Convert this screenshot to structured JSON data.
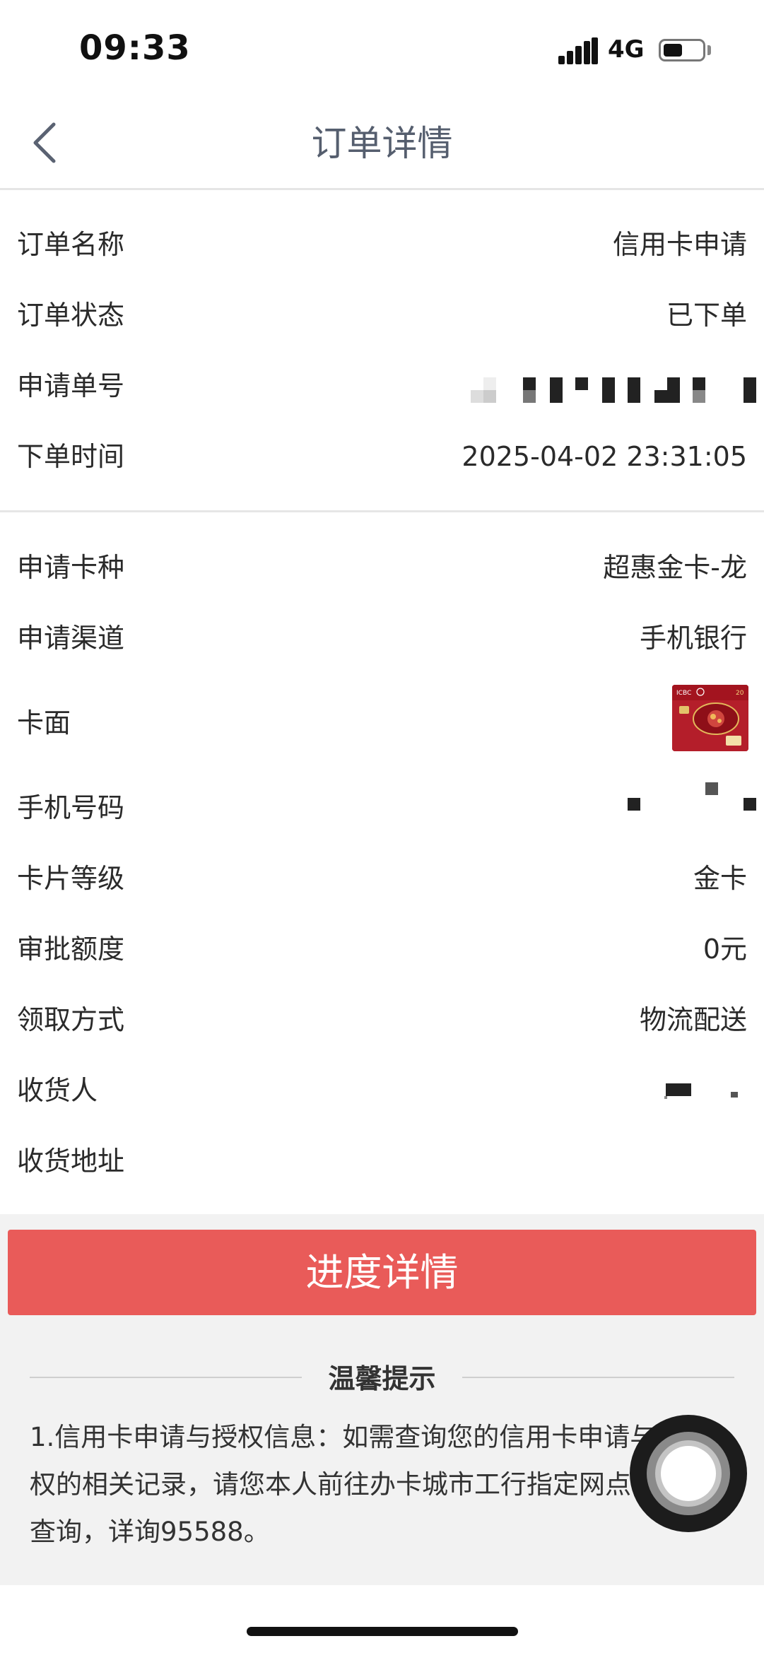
{
  "status_bar": {
    "time": "09:33",
    "network": "4G",
    "battery_level": 0.5
  },
  "nav": {
    "title": "订单详情",
    "back_icon": "chevron-left-icon"
  },
  "order_info": [
    {
      "label": "订单名称",
      "value": "信用卡申请"
    },
    {
      "label": "订单状态",
      "value": "已下单"
    },
    {
      "label": "申请单号",
      "value": ""
    },
    {
      "label": "下单时间",
      "value": "2025-04-02 23:31:05"
    }
  ],
  "card_info": [
    {
      "label": "申请卡种",
      "value": "超惠金卡-龙"
    },
    {
      "label": "申请渠道",
      "value": "手机银行"
    },
    {
      "label": "卡面",
      "value": ""
    },
    {
      "label": "手机号码",
      "value": ""
    },
    {
      "label": "卡片等级",
      "value": "金卡"
    },
    {
      "label": "审批额度",
      "value": "0元"
    },
    {
      "label": "领取方式",
      "value": "物流配送"
    },
    {
      "label": "收货人",
      "value": ""
    },
    {
      "label": "收货地址",
      "value": ""
    }
  ],
  "card_face": {
    "color": "#b41e2a",
    "logo_text": "ICBC"
  },
  "progress_button": {
    "label": "进度详情",
    "color": "#e95b59"
  },
  "tips": {
    "title": "温馨提示",
    "text": "1.信用卡申请与授权信息：如需查询您的信用卡申请与授权的相关记录，请您本人前往办卡城市工行指定网点申请查询，详询95588。"
  }
}
